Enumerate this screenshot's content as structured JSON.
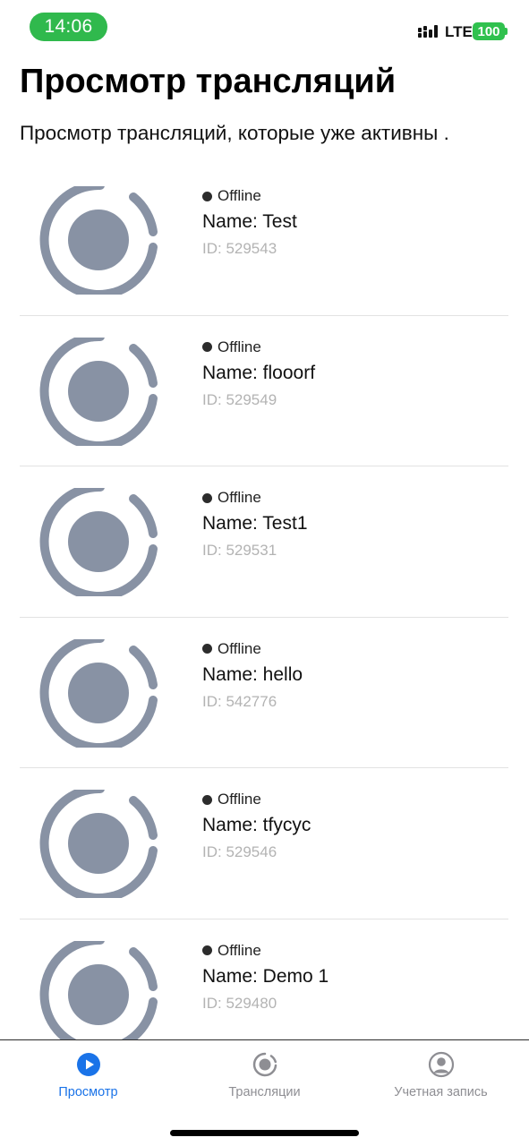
{
  "status_bar": {
    "time": "14:06",
    "network": "LTE",
    "battery": "100",
    "colors": {
      "time_pill": "#30b94d",
      "battery": "#30c14e"
    }
  },
  "header": {
    "title": "Просмотр трансляций",
    "subtitle": "Просмотр трансляций, которые уже активны ."
  },
  "streams": [
    {
      "status": "Offline",
      "name": "Name: Test",
      "id": "ID: 529543",
      "thumb_icon": "broadcast-placeholder-icon"
    },
    {
      "status": "Offline",
      "name": "Name: flooorf",
      "id": "ID: 529549",
      "thumb_icon": "broadcast-placeholder-icon"
    },
    {
      "status": "Offline",
      "name": "Name: Test1",
      "id": "ID: 529531",
      "thumb_icon": "broadcast-placeholder-icon"
    },
    {
      "status": "Offline",
      "name": "Name: hello",
      "id": "ID: 542776",
      "thumb_icon": "broadcast-placeholder-icon"
    },
    {
      "status": "Offline",
      "name": "Name: tfycyc",
      "id": "ID: 529546",
      "thumb_icon": "broadcast-placeholder-icon"
    },
    {
      "status": "Offline",
      "name": "Name: Demo 1",
      "id": "ID: 529480",
      "thumb_icon": "broadcast-placeholder-icon"
    }
  ],
  "tabs": [
    {
      "label": "Просмотр",
      "icon": "play-icon",
      "active": true
    },
    {
      "label": "Трансляции",
      "icon": "broadcast-icon",
      "active": false
    },
    {
      "label": "Учетная запись",
      "icon": "account-icon",
      "active": false
    }
  ],
  "colors": {
    "accent": "#1a73e8",
    "placeholder": "#8892a4",
    "id_text": "#b3b3b3",
    "inactive_tab": "#8e8e93"
  }
}
